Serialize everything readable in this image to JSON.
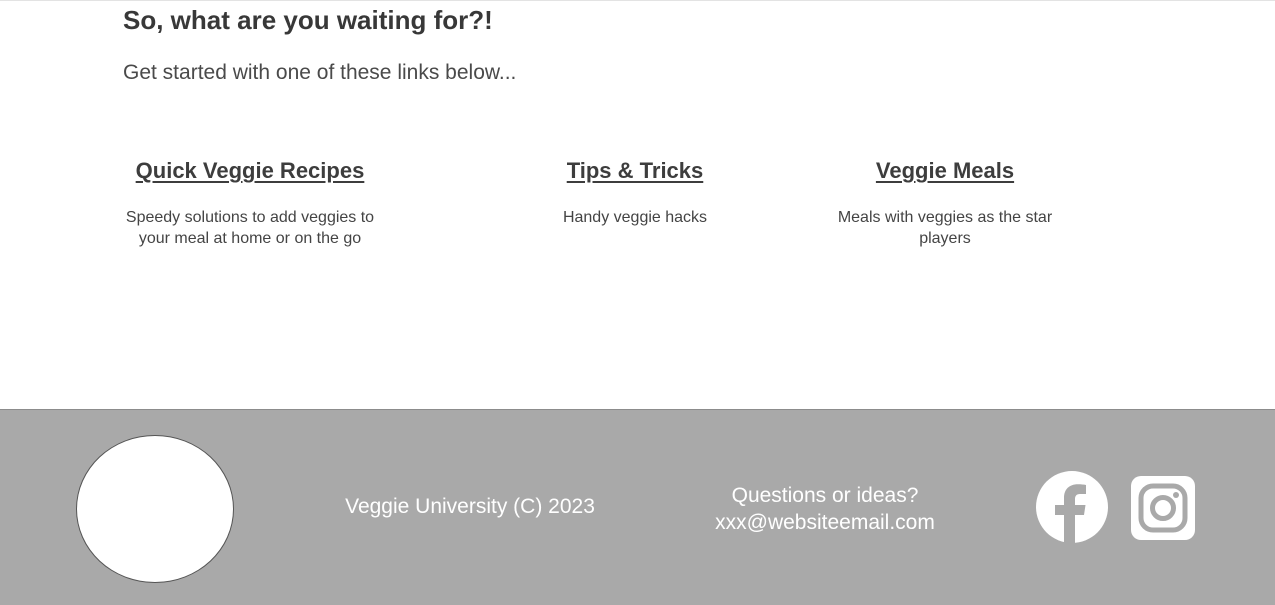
{
  "hero": {
    "headline": "So, what are you waiting for?!",
    "subhead": "Get started with one of these links below..."
  },
  "links": [
    {
      "title": "Quick Veggie Recipes",
      "desc_lines": [
        "Speedy solutions to add veggies to",
        "your meal at home or on the go"
      ]
    },
    {
      "title": "Tips & Tricks",
      "desc_lines": [
        "Handy veggie hacks"
      ]
    },
    {
      "title": "Veggie Meals",
      "desc_lines": [
        "Meals with veggies as the star",
        "players"
      ]
    }
  ],
  "footer": {
    "copyright": "Veggie University (C) 2023",
    "contact_line1": "Questions or ideas?",
    "contact_line2": "xxx@websiteemail.com",
    "social_icons": [
      "facebook-icon",
      "instagram-icon"
    ],
    "background_color": "#a9a9a9"
  }
}
